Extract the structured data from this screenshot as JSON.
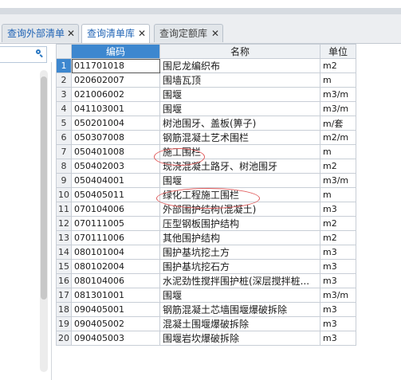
{
  "tabs": [
    {
      "label": "查询外部清单",
      "close": "✕"
    },
    {
      "label": "查询清单库",
      "close": "✕"
    },
    {
      "label": "查询定额库",
      "close": "✕"
    }
  ],
  "columns": {
    "code": "编码",
    "name": "名称",
    "unit": "单位"
  },
  "rows": [
    {
      "num": "1",
      "code": "011701018",
      "name": "围尼龙编织布",
      "unit": "m2"
    },
    {
      "num": "2",
      "code": "020602007",
      "name": "围墙瓦顶",
      "unit": "m"
    },
    {
      "num": "3",
      "code": "021006002",
      "name": "围堰",
      "unit": "m3/m"
    },
    {
      "num": "4",
      "code": "041103001",
      "name": "围堰",
      "unit": "m3/m"
    },
    {
      "num": "5",
      "code": "050201004",
      "name": "树池围牙、盖板(箅子)",
      "unit": "m/套"
    },
    {
      "num": "6",
      "code": "050307008",
      "name": "钢筋混凝土艺术围栏",
      "unit": "m2/m"
    },
    {
      "num": "7",
      "code": "050401008",
      "name": "施工围栏",
      "unit": "m"
    },
    {
      "num": "8",
      "code": "050402003",
      "name": "现浇混凝土路牙、树池围牙",
      "unit": "m2"
    },
    {
      "num": "9",
      "code": "050404001",
      "name": "围堰",
      "unit": "m3/m"
    },
    {
      "num": "10",
      "code": "050405011",
      "name": "绿化工程施工围栏",
      "unit": "m"
    },
    {
      "num": "11",
      "code": "070104006",
      "name": "外部围护结构(混凝土)",
      "unit": "m3"
    },
    {
      "num": "12",
      "code": "070111005",
      "name": "压型钢板围护结构",
      "unit": "m2"
    },
    {
      "num": "13",
      "code": "070111006",
      "name": "其他围护结构",
      "unit": "m2"
    },
    {
      "num": "14",
      "code": "080101004",
      "name": "围护基坑挖土方",
      "unit": "m3"
    },
    {
      "num": "15",
      "code": "080102004",
      "name": "围护基坑挖石方",
      "unit": "m3"
    },
    {
      "num": "16",
      "code": "080104006",
      "name": "水泥劲性搅拌围护桩(深层搅拌桩...",
      "unit": "m3"
    },
    {
      "num": "17",
      "code": "081301001",
      "name": "围堰",
      "unit": "m3/m"
    },
    {
      "num": "18",
      "code": "090405001",
      "name": "钢筋混凝土芯墙围堰爆破拆除",
      "unit": "m3"
    },
    {
      "num": "19",
      "code": "090405002",
      "name": "混凝土围堰爆破拆除",
      "unit": "m3"
    },
    {
      "num": "20",
      "code": "090405003",
      "name": "围堰岩坎爆破拆除",
      "unit": "m3"
    }
  ],
  "colors": {
    "accent": "#3d87cf",
    "tab_text": "#1f63b5",
    "highlight": "#e05a5a"
  }
}
